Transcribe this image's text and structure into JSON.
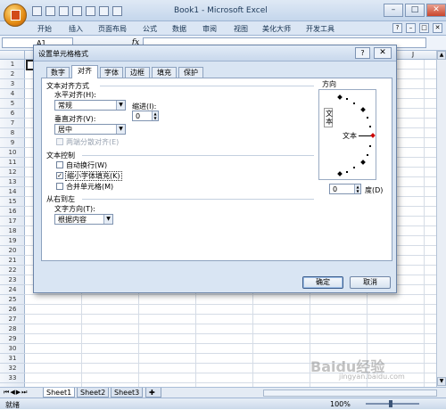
{
  "window": {
    "title": "Book1 - Microsoft Excel",
    "min": "–",
    "max": "□",
    "close": "✕"
  },
  "ribbon": {
    "tabs": [
      "开始",
      "插入",
      "页面布局",
      "公式",
      "数据",
      "审阅",
      "视图",
      "美化大师",
      "开发工具"
    ]
  },
  "formula_bar": {
    "name_box": "A1",
    "fx": "fx"
  },
  "grid": {
    "rows": [
      "1",
      "2",
      "3",
      "4",
      "5",
      "6",
      "7",
      "8",
      "9",
      "10",
      "11",
      "12",
      "13",
      "14",
      "15",
      "16",
      "17",
      "18",
      "19",
      "20",
      "21",
      "22",
      "23",
      "24",
      "25",
      "26",
      "27",
      "28",
      "29",
      "30",
      "31",
      "32",
      "33"
    ],
    "col_j": "J"
  },
  "sheets": {
    "tabs": [
      "Sheet1",
      "Sheet2",
      "Sheet3"
    ],
    "active_index": 0
  },
  "status": {
    "text": "就绪",
    "zoom": "100%"
  },
  "dialog": {
    "title": "设置单元格格式",
    "help": "?",
    "close": "✕",
    "tabs": [
      "数字",
      "对齐",
      "字体",
      "边框",
      "填充",
      "保护"
    ],
    "active_tab": "对齐",
    "section_alignment": "文本对齐方式",
    "h_align_label": "水平对齐(H):",
    "h_align_value": "常规",
    "indent_label": "缩进(I):",
    "indent_value": "0",
    "v_align_label": "垂直对齐(V):",
    "v_align_value": "居中",
    "justify_distributed_label": "两端分散对齐(E)",
    "section_control": "文本控制",
    "wrap_text_label": "自动换行(W)",
    "shrink_to_fit_label": "缩小字体填充(K)",
    "shrink_to_fit_checked": true,
    "merge_cells_label": "合并单元格(M)",
    "section_rtl": "从右到左",
    "text_direction_label": "文字方向(T):",
    "text_direction_value": "根据内容",
    "orientation_label": "方向",
    "vertical_text": "文本",
    "dial_text": "文本",
    "degree_value": "0",
    "degree_label": "度(D)",
    "ok_label": "确定",
    "cancel_label": "取消"
  },
  "watermark": {
    "main": "Baidu经验",
    "sub": "jingyan.baidu.com"
  }
}
